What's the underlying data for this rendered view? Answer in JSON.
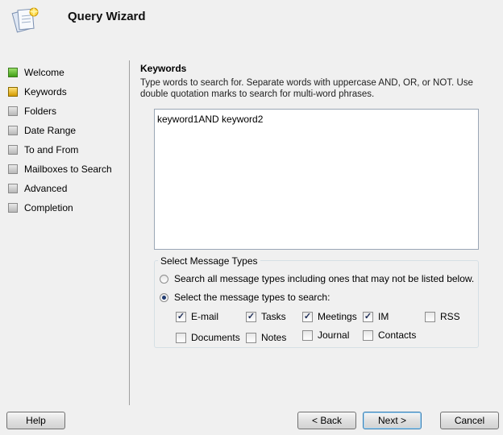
{
  "header": {
    "title": "Query Wizard",
    "icon": "wizard-icon"
  },
  "nav": {
    "items": [
      {
        "label": "Welcome",
        "status": "done"
      },
      {
        "label": "Keywords",
        "status": "current"
      },
      {
        "label": "Folders",
        "status": "pending"
      },
      {
        "label": "Date Range",
        "status": "pending"
      },
      {
        "label": "To and From",
        "status": "pending"
      },
      {
        "label": "Mailboxes to Search",
        "status": "pending"
      },
      {
        "label": "Advanced",
        "status": "pending"
      },
      {
        "label": "Completion",
        "status": "pending"
      }
    ]
  },
  "main": {
    "title": "Keywords",
    "description": "Type words to search for. Separate words with uppercase AND, OR, or NOT. Use double quotation marks to search for multi-word phrases.",
    "keywords_value": "keyword1AND keyword2",
    "message_types": {
      "legend": "Select Message Types",
      "option_all": "Search all message types including ones that may not be listed below.",
      "option_select": "Select the message types to search:",
      "selected_option": "select",
      "types": [
        {
          "label": "E-mail",
          "checked": true
        },
        {
          "label": "Tasks",
          "checked": true
        },
        {
          "label": "Meetings",
          "checked": true
        },
        {
          "label": "IM",
          "checked": true
        },
        {
          "label": "RSS",
          "checked": false
        },
        {
          "label": "Documents",
          "checked": false
        },
        {
          "label": "Notes",
          "checked": false
        },
        {
          "label": "Journal",
          "checked": false
        },
        {
          "label": "Contacts",
          "checked": false
        }
      ]
    }
  },
  "buttons": {
    "help": "Help",
    "back": "< Back",
    "next": "Next >",
    "cancel": "Cancel"
  }
}
